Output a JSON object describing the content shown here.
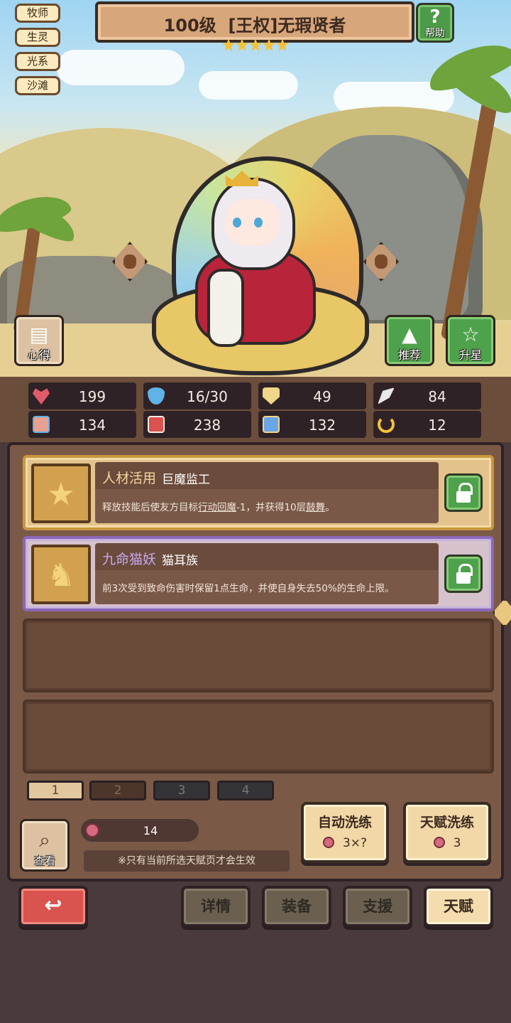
{
  "tags": [
    "牧师",
    "生灵",
    "光系",
    "沙滩"
  ],
  "title": {
    "level": "100级",
    "name": "[王权]无瑕贤者",
    "stars": 5
  },
  "help": {
    "label": "帮助",
    "glyph": "?"
  },
  "side_buttons": {
    "xinde": "心得",
    "tuijian": "推荐",
    "shengxing": "升星"
  },
  "stats": [
    {
      "icon": "heart-icon",
      "value": "199",
      "color": "#e05a6a"
    },
    {
      "icon": "water-drop-icon",
      "value": "16/30",
      "color": "#5fb3e6"
    },
    {
      "icon": "shield-icon",
      "value": "49",
      "color": "#f0d58a"
    },
    {
      "icon": "wing-icon",
      "value": "84",
      "color": "#e8e8e8"
    },
    {
      "icon": "fist-icon",
      "value": "134",
      "color": "#e8a090"
    },
    {
      "icon": "book-icon",
      "value": "238",
      "color": "#d9534f"
    },
    {
      "icon": "boot-icon",
      "value": "132",
      "color": "#6aa6e6"
    },
    {
      "icon": "horseshoe-icon",
      "value": "12",
      "color": "#f3c23a"
    }
  ],
  "talents": [
    {
      "name": "人材活用",
      "tribe": "巨魔监工",
      "desc_parts": [
        "释放技能后使友方目标",
        "行动回魔",
        "-1，并获得10层",
        "鼓舞",
        "。"
      ],
      "icon": "star-icon",
      "rarity": "gold"
    },
    {
      "name": "九命猫妖",
      "tribe": "猫耳族",
      "desc": "前3次受到致命伤害时保留1点生命，并使自身失去50%的生命上限。",
      "icon": "cat-icon",
      "rarity": "purple"
    }
  ],
  "pages": [
    "1",
    "2",
    "3",
    "4"
  ],
  "active_page": "1",
  "view_label": "查看",
  "resource_count": "14",
  "note": "※只有当前所选天赋页才会生效",
  "auto_refine": {
    "label": "自动洗练",
    "cost": "3×?"
  },
  "talent_refine": {
    "label": "天赋洗练",
    "cost": "3"
  },
  "nav": {
    "details": "详情",
    "equipment": "装备",
    "support": "支援",
    "talent": "天赋"
  }
}
